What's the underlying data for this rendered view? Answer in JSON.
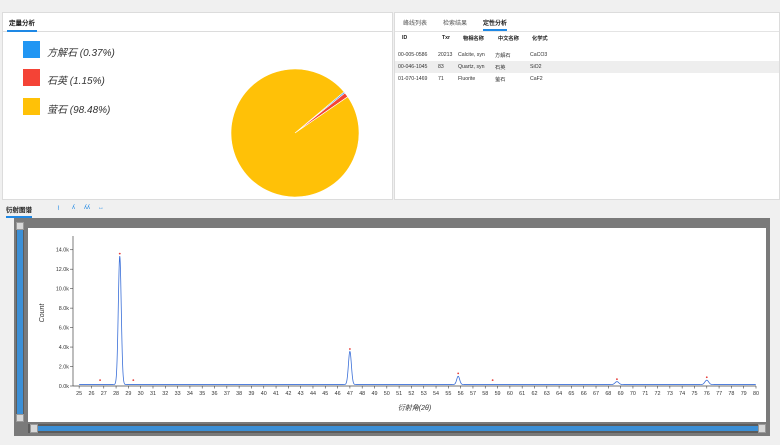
{
  "quant_panel": {
    "tab_label": "定量分析",
    "legend": [
      {
        "label": "方解石 (0.37%)",
        "color": "#2196f3"
      },
      {
        "label": "石英 (1.15%)",
        "color": "#f44336"
      },
      {
        "label": "萤石 (98.48%)",
        "color": "#ffc107"
      }
    ],
    "pie": [
      {
        "name": "方解石",
        "percent": 0.37,
        "color": "#2196f3"
      },
      {
        "name": "石英",
        "percent": 1.15,
        "color": "#f44336"
      },
      {
        "name": "萤石",
        "percent": 98.48,
        "color": "#ffc107"
      }
    ]
  },
  "qual_panel": {
    "tabs": [
      {
        "label": "峰线列表",
        "active": false
      },
      {
        "label": "检索结果",
        "active": false
      },
      {
        "label": "定性分析",
        "active": true
      }
    ],
    "columns": [
      "ID",
      "Txr",
      "物相名称",
      "中文名称",
      "化学式"
    ],
    "rows": [
      [
        "00-005-0586",
        "20213",
        "Calcite, syn",
        "方解石",
        "CaCO3"
      ],
      [
        "00-046-1045",
        "83",
        "Quartz, syn",
        "石英",
        "SiO2"
      ],
      [
        "01-070-1469",
        "71",
        "Fluorite",
        "萤石",
        "CaF2"
      ]
    ]
  },
  "bottom": {
    "tab_label": "衍射图谱",
    "tool_icons": [
      "ruler-icon",
      "peak-marker-icon",
      "peak-group-icon",
      "scale-icon"
    ],
    "tool_glyphs": [
      "⌇",
      "ʎ",
      "ʎʎ",
      "↔"
    ]
  },
  "chart_data": {
    "type": "line",
    "xlabel": "衍射角(2θ)",
    "ylabel": "Count",
    "xlim": [
      24.5,
      80
    ],
    "ylim": [
      0,
      15000
    ],
    "x_ticks": [
      25,
      26,
      27,
      28,
      29,
      30,
      31,
      32,
      33,
      34,
      35,
      36,
      37,
      38,
      39,
      40,
      41,
      42,
      43,
      44,
      45,
      46,
      47,
      48,
      49,
      50,
      51,
      52,
      53,
      54,
      55,
      56,
      57,
      58,
      59,
      60,
      61,
      62,
      63,
      64,
      65,
      66,
      67,
      68,
      69,
      70,
      71,
      72,
      73,
      74,
      75,
      76,
      77,
      78,
      79,
      80
    ],
    "y_ticks": [
      0,
      2000,
      4000,
      6000,
      8000,
      10000,
      12000,
      14000
    ],
    "y_tick_labels": [
      "0.0k",
      "2.0k",
      "4.0k",
      "6.0k",
      "8.0k",
      "10.0k",
      "12.0k",
      "14.0k"
    ],
    "grid": false,
    "baseline": 150,
    "peaks": [
      {
        "x": 28.3,
        "y": 13200,
        "width": 0.12
      },
      {
        "x": 47.0,
        "y": 3400,
        "width": 0.12
      },
      {
        "x": 55.8,
        "y": 850,
        "width": 0.12
      },
      {
        "x": 68.7,
        "y": 300,
        "width": 0.15
      },
      {
        "x": 76.0,
        "y": 450,
        "width": 0.15
      }
    ],
    "markers": [
      {
        "x": 26.7,
        "y": 600
      },
      {
        "x": 28.3,
        "y": 13600
      },
      {
        "x": 29.4,
        "y": 600
      },
      {
        "x": 47.0,
        "y": 3800
      },
      {
        "x": 55.8,
        "y": 1300
      },
      {
        "x": 58.6,
        "y": 600
      },
      {
        "x": 68.7,
        "y": 700
      },
      {
        "x": 76.0,
        "y": 900
      }
    ],
    "line_color": "#3a6fd8",
    "marker_color": "#e53935"
  }
}
